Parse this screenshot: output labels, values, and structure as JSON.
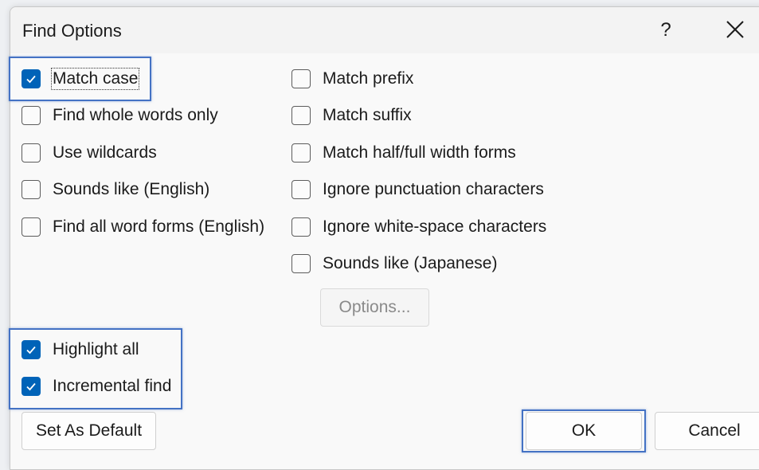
{
  "dialog": {
    "title": "Find Options",
    "help_label": "?",
    "close_icon": "close-icon"
  },
  "left_options": [
    {
      "label": "Match case",
      "checked": true
    },
    {
      "label": "Find whole words only",
      "checked": false
    },
    {
      "label": "Use wildcards",
      "checked": false
    },
    {
      "label": "Sounds like (English)",
      "checked": false
    },
    {
      "label": "Find all word forms (English)",
      "checked": false
    }
  ],
  "right_options": [
    {
      "label": "Match prefix",
      "checked": false
    },
    {
      "label": "Match suffix",
      "checked": false
    },
    {
      "label": "Match half/full width forms",
      "checked": false
    },
    {
      "label": "Ignore punctuation characters",
      "checked": false
    },
    {
      "label": "Ignore white-space characters",
      "checked": false
    },
    {
      "label": "Sounds like (Japanese)",
      "checked": false
    }
  ],
  "options_button": {
    "label": "Options...",
    "enabled": false
  },
  "bottom_options": [
    {
      "label": "Highlight all",
      "checked": true
    },
    {
      "label": "Incremental find",
      "checked": true
    }
  ],
  "buttons": {
    "set_default": "Set As Default",
    "ok": "OK",
    "cancel": "Cancel"
  },
  "colors": {
    "accent": "#0063b8",
    "highlight_box": "#4472c4"
  }
}
